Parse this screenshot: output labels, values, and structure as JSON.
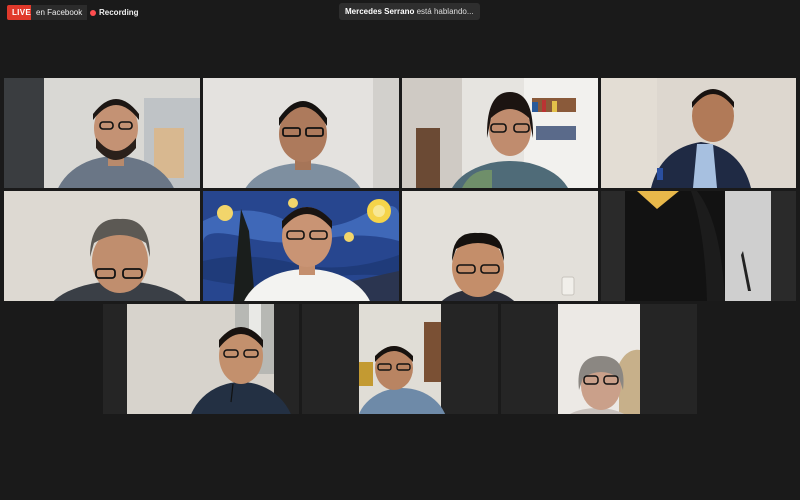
{
  "live": {
    "badge": "LIVE",
    "platform": "en Facebook"
  },
  "recording": {
    "label": "Recording"
  },
  "active_speaker": {
    "name": "Mercedes Serrano",
    "suffix": " está hablando..."
  },
  "participants": [
    {
      "id": 1
    },
    {
      "id": 2
    },
    {
      "id": 3
    },
    {
      "id": 4
    },
    {
      "id": 5
    },
    {
      "id": 6
    },
    {
      "id": 7
    },
    {
      "id": 8
    },
    {
      "id": 9
    },
    {
      "id": 10
    },
    {
      "id": 11
    }
  ]
}
